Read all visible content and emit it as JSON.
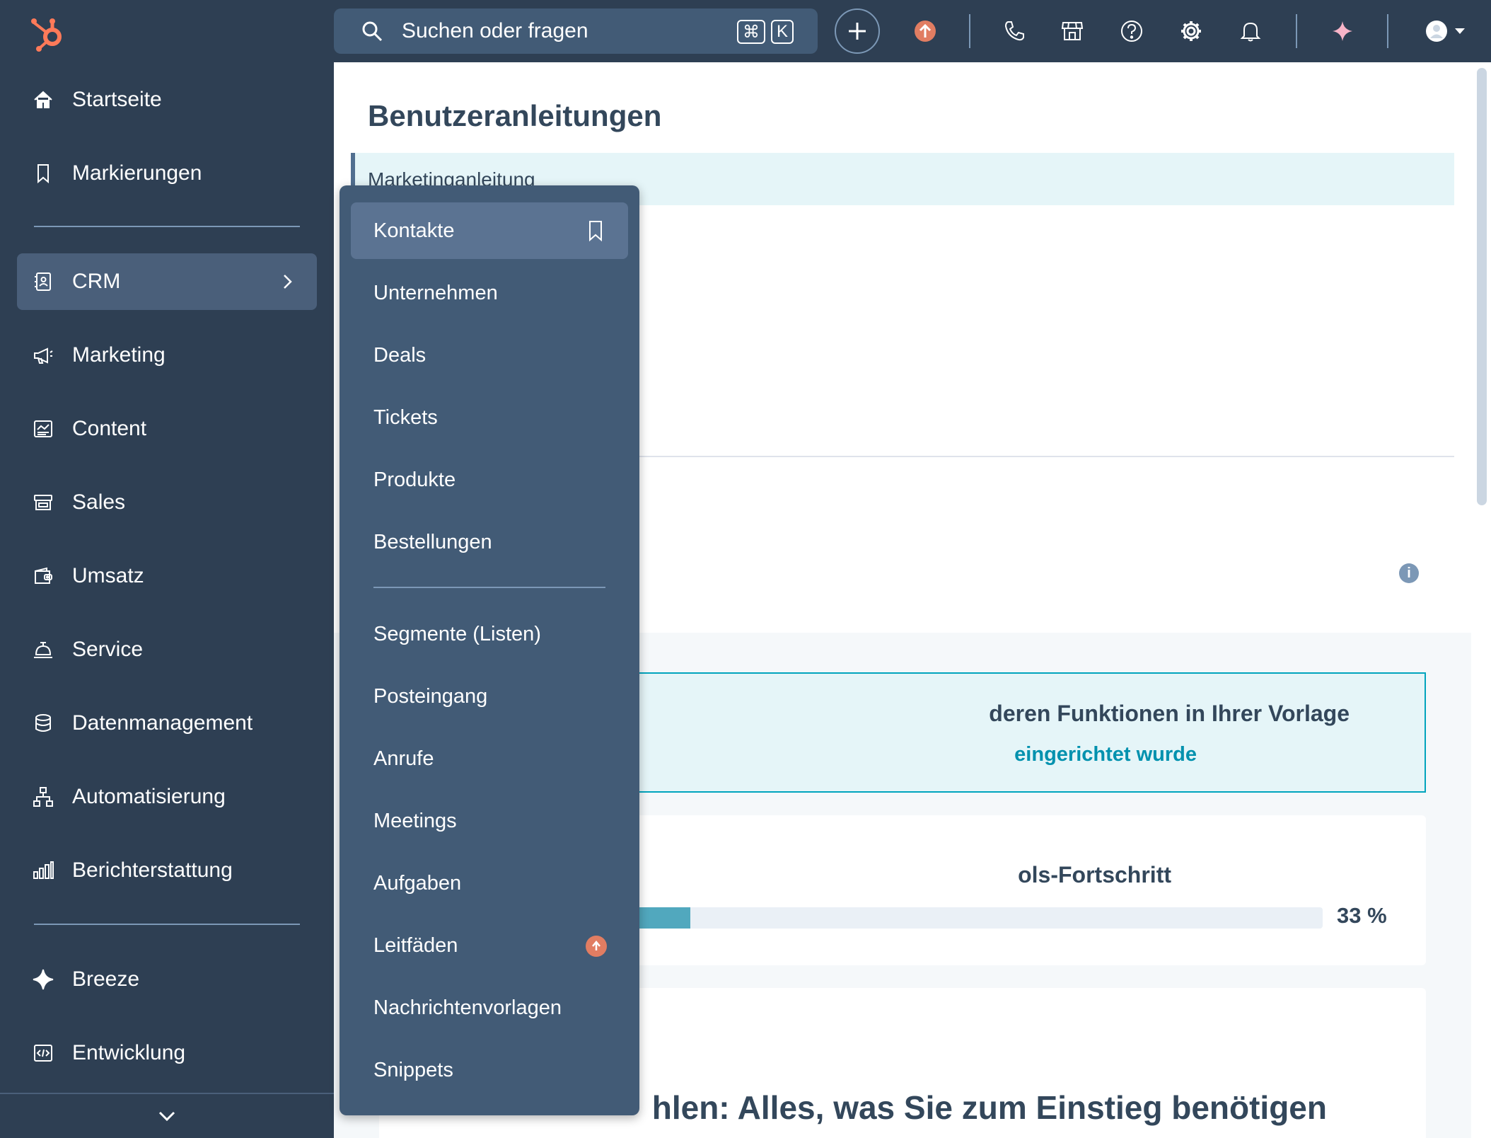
{
  "sidebar": {
    "items": [
      {
        "label": "Startseite",
        "icon": "home-icon"
      },
      {
        "label": "Markierungen",
        "icon": "bookmark-icon"
      },
      {
        "label": "CRM",
        "icon": "contacts-book-icon"
      },
      {
        "label": "Marketing",
        "icon": "megaphone-icon"
      },
      {
        "label": "Content",
        "icon": "content-icon"
      },
      {
        "label": "Sales",
        "icon": "sales-icon"
      },
      {
        "label": "Umsatz",
        "icon": "wallet-icon"
      },
      {
        "label": "Service",
        "icon": "service-bell-icon"
      },
      {
        "label": "Datenmanagement",
        "icon": "database-icon"
      },
      {
        "label": "Automatisierung",
        "icon": "workflow-icon"
      },
      {
        "label": "Berichterstattung",
        "icon": "bar-chart-icon"
      },
      {
        "label": "Breeze",
        "icon": "sparkle-icon"
      },
      {
        "label": "Entwicklung",
        "icon": "code-icon"
      }
    ]
  },
  "topbar": {
    "search_placeholder": "Suchen oder fragen",
    "shortcut_cmd": "⌘",
    "shortcut_key": "K"
  },
  "main": {
    "page_title": "Benutzeranleitungen",
    "tab_label": "Marketinganleitung",
    "template_title": "deren Funktionen in Ihrer Vorlage",
    "template_link": "eingerichtet wurde",
    "progress_title": "ols-Fortschritt",
    "progress_percent_label": "33 %",
    "progress_value": 0.33,
    "bottom_title": "hlen: Alles, was Sie zum Einstieg benötigen"
  },
  "dropdown": {
    "items": [
      {
        "label": "Kontakte"
      },
      {
        "label": "Unternehmen"
      },
      {
        "label": "Deals"
      },
      {
        "label": "Tickets"
      },
      {
        "label": "Produkte"
      },
      {
        "label": "Bestellungen"
      },
      {
        "label": "Segmente (Listen)"
      },
      {
        "label": "Posteingang"
      },
      {
        "label": "Anrufe"
      },
      {
        "label": "Meetings"
      },
      {
        "label": "Aufgaben"
      },
      {
        "label": "Leitfäden"
      },
      {
        "label": "Nachrichtenvorlagen"
      },
      {
        "label": "Snippets"
      }
    ]
  },
  "colors": {
    "sidebar_bg": "#2e3f53",
    "dropdown_bg": "#425b76",
    "accent_teal": "#00a4bd",
    "upgrade_badge": "#e17d62"
  }
}
